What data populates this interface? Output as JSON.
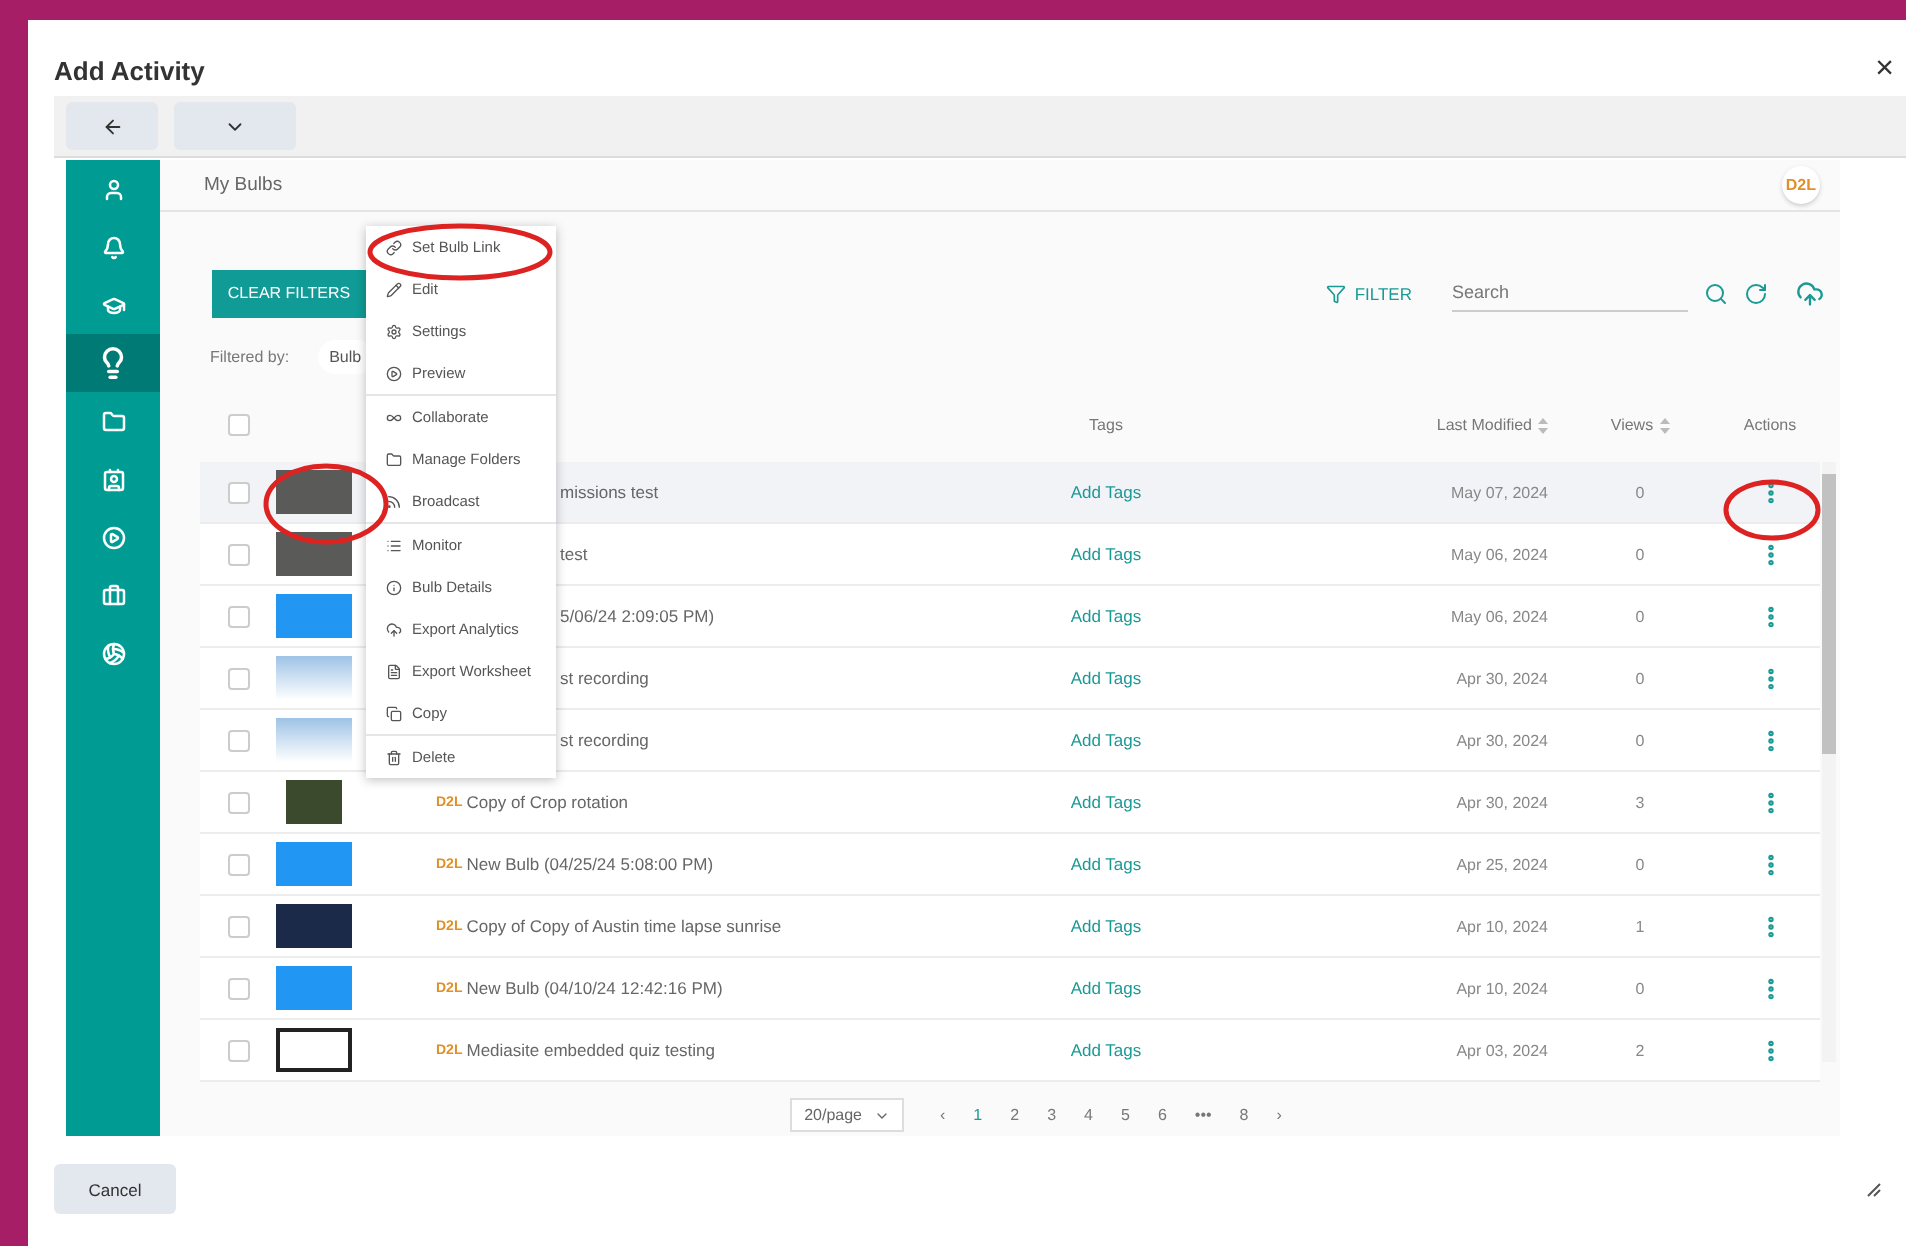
{
  "dialog": {
    "title": "Add Activity",
    "close": "×"
  },
  "sidebar": {
    "items": [
      {
        "selected": false
      },
      {
        "selected": false
      },
      {
        "selected": false
      },
      {
        "selected": true
      },
      {
        "selected": false
      },
      {
        "selected": false
      },
      {
        "selected": false
      },
      {
        "selected": false
      },
      {
        "selected": false
      }
    ]
  },
  "page": {
    "title": "My Bulbs",
    "logo": "D2L"
  },
  "clear_filters": "CLEAR FILTERS",
  "filter": "FILTER",
  "search": {
    "placeholder": "Search"
  },
  "filtered_by": {
    "label": "Filtered by:",
    "chip": "Bulb"
  },
  "menu": {
    "groups": [
      [
        "Set Bulb Link",
        "Edit",
        "Settings",
        "Preview"
      ],
      [
        "Collaborate",
        "Manage Folders",
        "Broadcast"
      ],
      [
        "Monitor",
        "Bulb Details",
        "Export Analytics",
        "Export Worksheet",
        "Copy"
      ],
      [
        "Delete"
      ]
    ]
  },
  "table": {
    "header_checked": false,
    "columns": [
      {
        "label": "Tags",
        "sortable": false
      },
      {
        "label": "Last Modified",
        "sortable": true
      },
      {
        "label": "Views",
        "sortable": true
      },
      {
        "label": "Actions",
        "sortable": false
      }
    ],
    "rows": [
      {
        "kind": "photo",
        "covered": true,
        "title": "missions test",
        "tags": "Add Tags",
        "modified": "May 07, 2024",
        "views": "0",
        "checked": false,
        "selected": true
      },
      {
        "kind": "photo",
        "covered": true,
        "title": "test",
        "tags": "Add Tags",
        "modified": "May 06, 2024",
        "views": "0",
        "checked": false,
        "selected": false
      },
      {
        "kind": "blue",
        "covered": true,
        "title": "5/06/24 2:09:05 PM)",
        "tags": "Add Tags",
        "modified": "May 06, 2024",
        "views": "0",
        "checked": false,
        "selected": false
      },
      {
        "kind": "diagram",
        "covered": true,
        "title": "st recording",
        "tags": "Add Tags",
        "modified": "Apr 30, 2024",
        "views": "0",
        "checked": false,
        "selected": false
      },
      {
        "kind": "diagram",
        "covered": true,
        "title": "st recording",
        "tags": "Add Tags",
        "modified": "Apr 30, 2024",
        "views": "0",
        "checked": false,
        "selected": false
      },
      {
        "kind": "small",
        "covered": false,
        "badge": "D2L",
        "title": "Copy of Crop rotation",
        "tags": "Add Tags",
        "modified": "Apr 30, 2024",
        "views": "3",
        "checked": false,
        "selected": false
      },
      {
        "kind": "blue",
        "covered": false,
        "badge": "D2L",
        "title": "New Bulb (04/25/24 5:08:00 PM)",
        "tags": "Add Tags",
        "modified": "Apr 25, 2024",
        "views": "0",
        "checked": false,
        "selected": false
      },
      {
        "kind": "night",
        "covered": false,
        "badge": "D2L",
        "title": "Copy of Copy of Austin time lapse sunrise",
        "tags": "Add Tags",
        "modified": "Apr 10, 2024",
        "views": "1",
        "checked": false,
        "selected": false
      },
      {
        "kind": "blue",
        "covered": false,
        "badge": "D2L",
        "title": "New Bulb (04/10/24 12:42:16 PM)",
        "tags": "Add Tags",
        "modified": "Apr 10, 2024",
        "views": "0",
        "checked": false,
        "selected": false
      },
      {
        "kind": "screen",
        "covered": false,
        "badge": "D2L",
        "title": "Mediasite embedded quiz testing",
        "tags": "Add Tags",
        "modified": "Apr 03, 2024",
        "views": "2",
        "checked": false,
        "selected": false
      }
    ]
  },
  "pagination": {
    "per_page": "20/page",
    "prev": "‹",
    "next": "›",
    "pages": [
      {
        "label": "1",
        "selected": true
      },
      {
        "label": "2",
        "selected": false
      },
      {
        "label": "3",
        "selected": false
      },
      {
        "label": "4",
        "selected": false
      },
      {
        "label": "5",
        "selected": false
      },
      {
        "label": "6",
        "selected": false
      },
      {
        "label": "•••",
        "selected": false
      },
      {
        "label": "8",
        "selected": false
      }
    ]
  },
  "cancel": "Cancel"
}
